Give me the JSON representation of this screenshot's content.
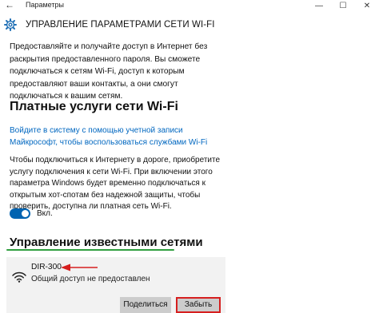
{
  "window": {
    "title": "Параметры",
    "minimize_glyph": "—",
    "maximize_glyph": "☐",
    "close_glyph": "✕",
    "back_glyph": "←"
  },
  "page": {
    "title": "УПРАВЛЕНИЕ ПАРАМЕТРАМИ СЕТИ WI-FI"
  },
  "intro_text": "Предоставляйте и получайте доступ в Интернет без раскрытия предоставленного пароля. Вы сможете подключаться к сетям Wi-Fi, доступ к которым предоставляют ваши контакты, а они смогут подключаться к вашим сетям.",
  "paid_services": {
    "heading": "Платные услуги сети Wi-Fi",
    "signin_link": "Войдите в систему с помощью учетной записи Майкрософт, чтобы воспользоваться службами Wi-Fi",
    "description": "Чтобы подключиться к Интернету в дороге, приобретите услугу подключения к сети Wi-Fi. При включении этого параметра Windows будет временно подключаться к открытым хот-спотам без надежной защиты, чтобы проверить, доступна ли платная сеть Wi-Fi.",
    "toggle_state": "on",
    "toggle_label": "Вкл."
  },
  "known_networks": {
    "heading": "Управление известными сетями",
    "network": {
      "name": "DIR-300",
      "status": "Общий доступ не предоставлен"
    },
    "share_button": "Поделиться",
    "forget_button": "Забыть"
  },
  "colors": {
    "accent": "#0063b1",
    "link": "#0067c0",
    "annotation_red": "#d61f1f",
    "annotation_green": "#2f9e3e"
  }
}
